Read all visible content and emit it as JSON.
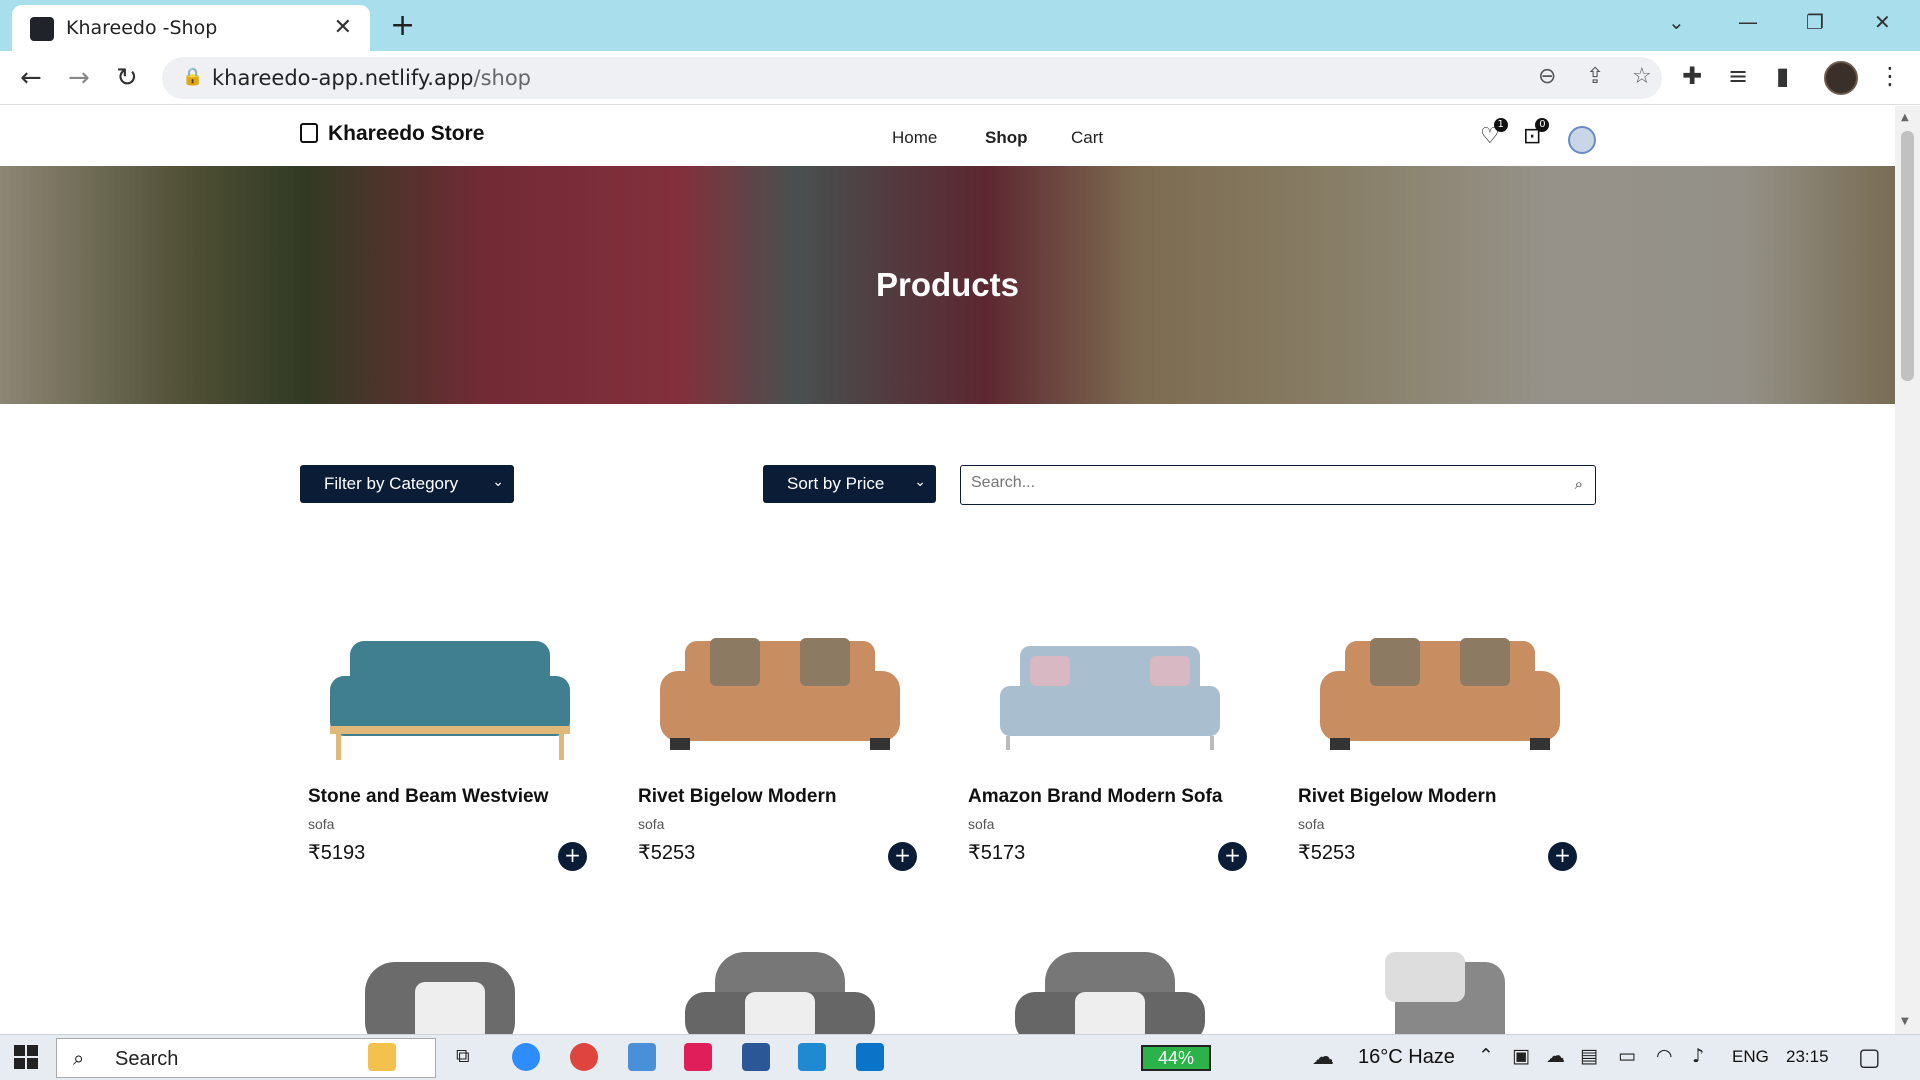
{
  "browser": {
    "tab_title": "Khareedo -Shop",
    "url_host": "khareedo-app.netlify.app",
    "url_path": "/shop",
    "new_tab_label": "+",
    "tab_close": "✕"
  },
  "site": {
    "brand": "Khareedo Store",
    "menu": [
      "Home",
      "Shop",
      "Cart"
    ],
    "active_menu": "Shop",
    "wishlist_count": "1",
    "cart_count": "0"
  },
  "hero": {
    "title": "Products"
  },
  "controls": {
    "filter_label": "Filter by Category",
    "sort_label": "Sort by Price",
    "search_placeholder": "Search..."
  },
  "products": [
    {
      "title": "Stone and Beam Westview",
      "category": "sofa",
      "price": "₹5193",
      "color": "#3f7f8f"
    },
    {
      "title": "Rivet Bigelow Modern",
      "category": "sofa",
      "price": "₹5253",
      "color": "#c98d62"
    },
    {
      "title": "Amazon Brand Modern Sofa",
      "category": "sofa",
      "price": "₹5173",
      "color": "#a9bfd0"
    },
    {
      "title": "Rivet Bigelow Modern",
      "category": "sofa",
      "price": "₹5253",
      "color": "#c98d62"
    }
  ],
  "taskbar": {
    "search_label": "Search",
    "battery": "44%",
    "weather": "16°C  Haze",
    "language": "ENG",
    "time": "23:15"
  }
}
